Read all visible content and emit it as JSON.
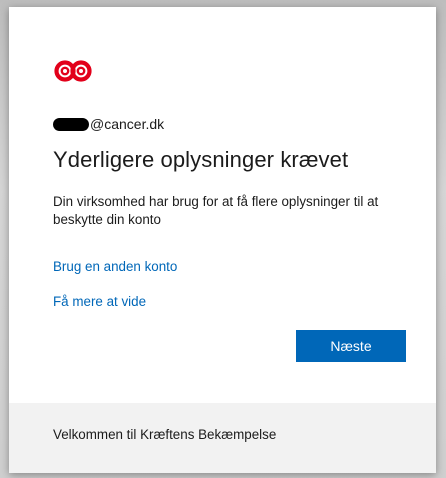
{
  "identity": {
    "email_suffix": "@cancer.dk"
  },
  "page": {
    "title": "Yderligere oplysninger krævet",
    "description": "Din virksomhed har brug for at få flere oplysninger til at beskytte din konto"
  },
  "links": {
    "use_other_account": "Brug en anden konto",
    "learn_more": "Få mere at vide"
  },
  "actions": {
    "next_label": "Næste"
  },
  "footer": {
    "text": "Velkommen til Kræftens Bekæmpelse"
  },
  "icons": {
    "logo": "kraeftens-bekaempelse-logo"
  },
  "colors": {
    "accent": "#0067b8",
    "logo_red": "#e2001a",
    "footer_bg": "#f2f2f2"
  }
}
